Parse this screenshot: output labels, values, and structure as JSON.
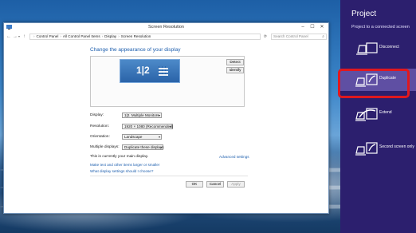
{
  "window": {
    "title": "Screen Resolution",
    "controls": {
      "minimize": "–",
      "maximize": "☐",
      "close": "✕"
    }
  },
  "address": {
    "crumbs": [
      "Control Panel",
      "All Control Panel Items",
      "Display",
      "Screen Resolution"
    ],
    "separator": "›",
    "search_placeholder": "Search Control Panel"
  },
  "icons": {
    "back": "←",
    "forward": "→",
    "recent": "▾",
    "up": "↑",
    "refresh": "⟳",
    "search": "⌕",
    "dropdown": "▾"
  },
  "main": {
    "heading": "Change the appearance of your display",
    "monitor_label": "1|2",
    "detect_label": "Detect",
    "identify_label": "Identify",
    "display_label": "Display:",
    "display_value": "1|2. Multiple Monitors",
    "resolution_label": "Resolution:",
    "resolution_value": "1920 × 1080 (Recommended)",
    "orientation_label": "Orientation:",
    "orientation_value": "Landscape",
    "multiple_label": "Multiple displays:",
    "multiple_value": "Duplicate these displays",
    "main_display_text": "This is currently your main display.",
    "advanced_link": "Advanced settings",
    "text_size_link": "Make text and other items larger or smaller",
    "choose_link": "What display settings should I choose?",
    "ok_label": "OK",
    "cancel_label": "Cancel",
    "apply_label": "Apply"
  },
  "charm": {
    "title": "Project",
    "subtitle": "Project to a connected screen",
    "options": [
      {
        "label": "Disconnect",
        "icon": "pc-screen-only-icon"
      },
      {
        "label": "Duplicate",
        "icon": "duplicate-icon",
        "selected": true
      },
      {
        "label": "Extend",
        "icon": "extend-icon"
      },
      {
        "label": "Second screen only",
        "icon": "second-screen-only-icon"
      }
    ],
    "colors": {
      "background": "#2c1f6e",
      "selected": "#5f4fa3",
      "highlight": "#e0181f"
    }
  }
}
